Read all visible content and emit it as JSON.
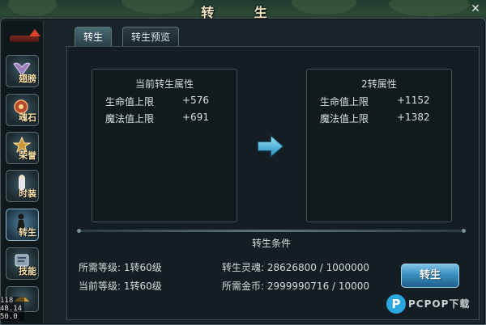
{
  "window": {
    "title": "转 生",
    "close_label": "✕"
  },
  "sidebar": {
    "items": [
      {
        "label": "翅膀",
        "icon": "wings-icon"
      },
      {
        "label": "魂石",
        "icon": "soul-stone-icon"
      },
      {
        "label": "荣誉",
        "icon": "honor-icon"
      },
      {
        "label": "时装",
        "icon": "fashion-icon"
      },
      {
        "label": "转生",
        "icon": "rebirth-icon"
      },
      {
        "label": "技能",
        "icon": "skill-icon"
      }
    ]
  },
  "tabs": [
    {
      "label": "转生"
    },
    {
      "label": "转生预览"
    }
  ],
  "current_panel": {
    "title": "当前转生属性",
    "stats": [
      {
        "name": "生命值上限",
        "value": "+576"
      },
      {
        "name": "魔法值上限",
        "value": "+691"
      }
    ]
  },
  "next_panel": {
    "title": "2转属性",
    "stats": [
      {
        "name": "生命值上限",
        "value": "+1152"
      },
      {
        "name": "魔法值上限",
        "value": "+1382"
      }
    ]
  },
  "conditions": {
    "title": "转生条件",
    "required_level": "所需等级: 1转60级",
    "current_level": "当前等级: 1转60级",
    "rebirth_soul": "转生灵魂: 28626800 / 1000000",
    "gold_required": "所需金币: 2999990716 / 10000"
  },
  "rebirth_button": "转生",
  "stats_overlay": [
    "118",
    "48.14",
    "50.0"
  ],
  "watermark": {
    "logo": "P",
    "text": "PCPOP下载"
  },
  "colors": {
    "accent": "#3a8fc0",
    "frame": "#182428",
    "text": "#d7e0e2"
  }
}
